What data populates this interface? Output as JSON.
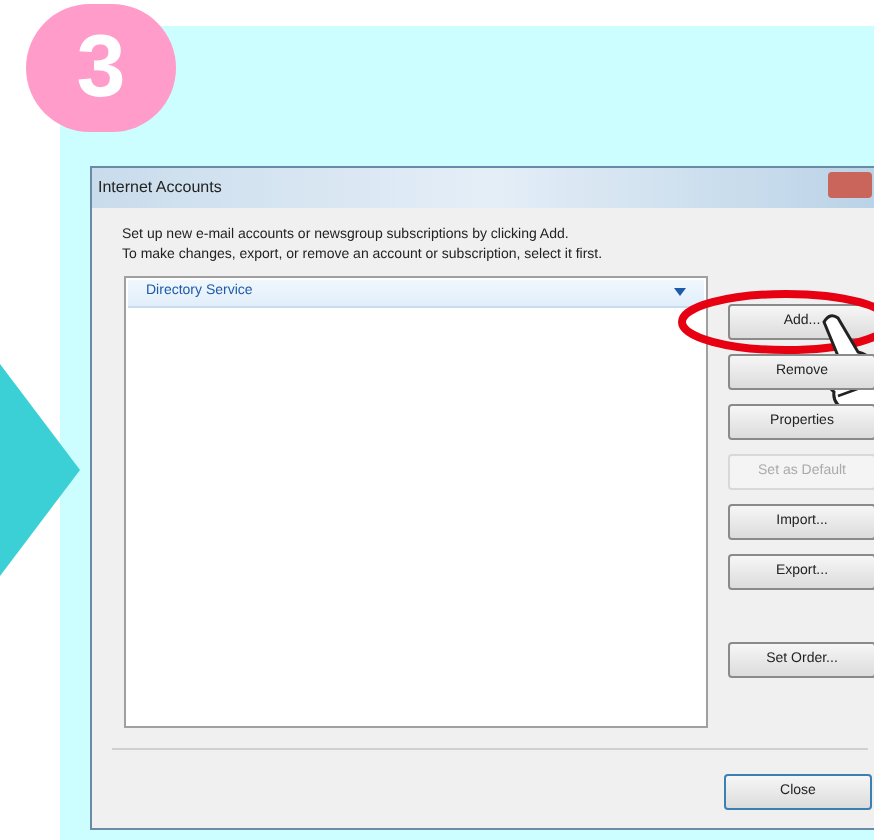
{
  "step": "3",
  "dialog": {
    "title": "Internet Accounts",
    "instructions": [
      "Set up new e-mail accounts or newsgroup subscriptions by clicking Add.",
      "To make changes, export, or remove an account or subscription, select it first."
    ],
    "list_groups": [
      {
        "label": "Directory Service",
        "expanded": true
      }
    ],
    "button_groups": [
      [
        {
          "label": "Add...",
          "disabled": false,
          "highlighted": true
        },
        {
          "label": "Remove",
          "disabled": false,
          "highlighted": false
        },
        {
          "label": "Properties",
          "disabled": false,
          "highlighted": false
        },
        {
          "label": "Set as Default",
          "disabled": true,
          "highlighted": false
        },
        {
          "label": "Import...",
          "disabled": false,
          "highlighted": false
        },
        {
          "label": "Export...",
          "disabled": false,
          "highlighted": false
        }
      ],
      [
        {
          "label": "Set Order...",
          "disabled": false,
          "highlighted": false
        }
      ]
    ],
    "close_button": "Close"
  }
}
